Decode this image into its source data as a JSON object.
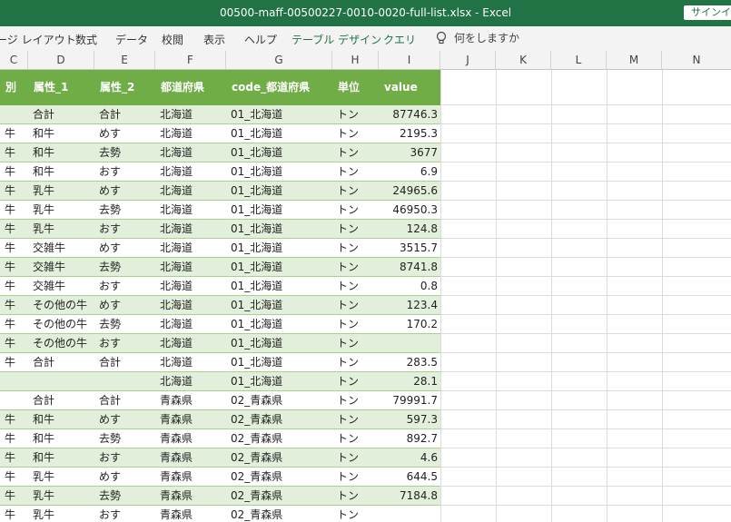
{
  "titlebar": {
    "title": "00500-maff-00500227-0010-0020-full-list.xlsx  -  Excel",
    "signin": "サインイ"
  },
  "ribbon": {
    "tabs": [
      "ージ レイアウト",
      "数式",
      "データ",
      "校閲",
      "表示",
      "ヘルプ"
    ],
    "context_tab": "テーブル デザイン",
    "extra_tab": "クエリ",
    "tellme": "何をしますか"
  },
  "columns": [
    "C",
    "D",
    "E",
    "F",
    "G",
    "H",
    "I",
    "J",
    "K",
    "L",
    "M",
    "N"
  ],
  "table": {
    "headers": [
      "別",
      "属性_1",
      "属性_2",
      "都道府県",
      "code_都道府県",
      "単位",
      "value"
    ],
    "rows": [
      [
        "",
        "合計",
        "合計",
        "北海道",
        "01_北海道",
        "トン",
        "87746.3"
      ],
      [
        "牛",
        "和牛",
        "めす",
        "北海道",
        "01_北海道",
        "トン",
        "2195.3"
      ],
      [
        "牛",
        "和牛",
        "去勢",
        "北海道",
        "01_北海道",
        "トン",
        "3677"
      ],
      [
        "牛",
        "和牛",
        "おす",
        "北海道",
        "01_北海道",
        "トン",
        "6.9"
      ],
      [
        "牛",
        "乳牛",
        "めす",
        "北海道",
        "01_北海道",
        "トン",
        "24965.6"
      ],
      [
        "牛",
        "乳牛",
        "去勢",
        "北海道",
        "01_北海道",
        "トン",
        "46950.3"
      ],
      [
        "牛",
        "乳牛",
        "おす",
        "北海道",
        "01_北海道",
        "トン",
        "124.8"
      ],
      [
        "牛",
        "交雑牛",
        "めす",
        "北海道",
        "01_北海道",
        "トン",
        "3515.7"
      ],
      [
        "牛",
        "交雑牛",
        "去勢",
        "北海道",
        "01_北海道",
        "トン",
        "8741.8"
      ],
      [
        "牛",
        "交雑牛",
        "おす",
        "北海道",
        "01_北海道",
        "トン",
        "0.8"
      ],
      [
        "牛",
        "その他の牛",
        "めす",
        "北海道",
        "01_北海道",
        "トン",
        "123.4"
      ],
      [
        "牛",
        "その他の牛",
        "去勢",
        "北海道",
        "01_北海道",
        "トン",
        "170.2"
      ],
      [
        "牛",
        "その他の牛",
        "おす",
        "北海道",
        "01_北海道",
        "トン",
        ""
      ],
      [
        "牛",
        "合計",
        "合計",
        "北海道",
        "01_北海道",
        "トン",
        "283.5"
      ],
      [
        "",
        "",
        "",
        "北海道",
        "01_北海道",
        "トン",
        "28.1"
      ],
      [
        "",
        "合計",
        "合計",
        "青森県",
        "02_青森県",
        "トン",
        "79991.7"
      ],
      [
        "牛",
        "和牛",
        "めす",
        "青森県",
        "02_青森県",
        "トン",
        "597.3"
      ],
      [
        "牛",
        "和牛",
        "去勢",
        "青森県",
        "02_青森県",
        "トン",
        "892.7"
      ],
      [
        "牛",
        "和牛",
        "おす",
        "青森県",
        "02_青森県",
        "トン",
        "4.6"
      ],
      [
        "牛",
        "乳牛",
        "めす",
        "青森県",
        "02_青森県",
        "トン",
        "644.5"
      ],
      [
        "牛",
        "乳牛",
        "去勢",
        "青森県",
        "02_青森県",
        "トン",
        "7184.8"
      ],
      [
        "牛",
        "乳牛",
        "おす",
        "青森県",
        "02_青森県",
        "トン",
        ""
      ]
    ]
  }
}
